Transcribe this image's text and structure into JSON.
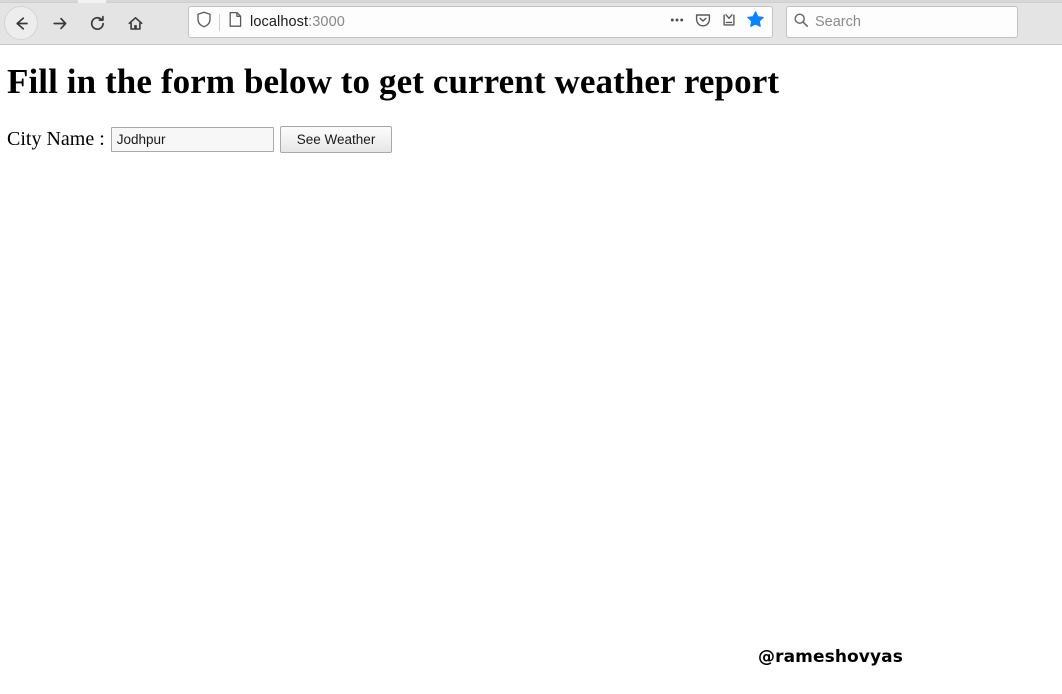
{
  "browser": {
    "nav": {
      "back": {
        "label": "Back",
        "icon": "arrow-left-icon"
      },
      "forward": {
        "label": "Forward",
        "icon": "arrow-right-icon"
      },
      "reload": {
        "label": "Reload",
        "icon": "reload-icon"
      },
      "home": {
        "label": "Home",
        "icon": "home-icon"
      }
    },
    "urlbar": {
      "shield_icon": "shield-icon",
      "page_icon": "page-document-icon",
      "host": "localhost",
      "port": ":3000",
      "full_url": "localhost:3000",
      "actions": [
        {
          "name": "page-actions-icon",
          "label": "..."
        },
        {
          "name": "pocket-icon",
          "label": "Save to Pocket"
        },
        {
          "name": "save-to-tray-icon",
          "label": "Save"
        },
        {
          "name": "bookmark-star-icon",
          "label": "Bookmark",
          "color": "#0a84ff"
        }
      ]
    },
    "search": {
      "icon": "search-icon",
      "placeholder": "Search",
      "value": ""
    }
  },
  "page": {
    "heading": "Fill in the form below to get current weather report",
    "form": {
      "city_label": "City Name :",
      "city_value": "Jodhpur",
      "city_placeholder": "",
      "submit_label": "See Weather"
    },
    "watermark": "@rameshovyas"
  },
  "colors": {
    "chrome_bg": "#e4e4e4",
    "page_bg": "#ffffff",
    "accent_star": "#0a84ff",
    "text": "#000000",
    "muted_text": "#878787"
  }
}
